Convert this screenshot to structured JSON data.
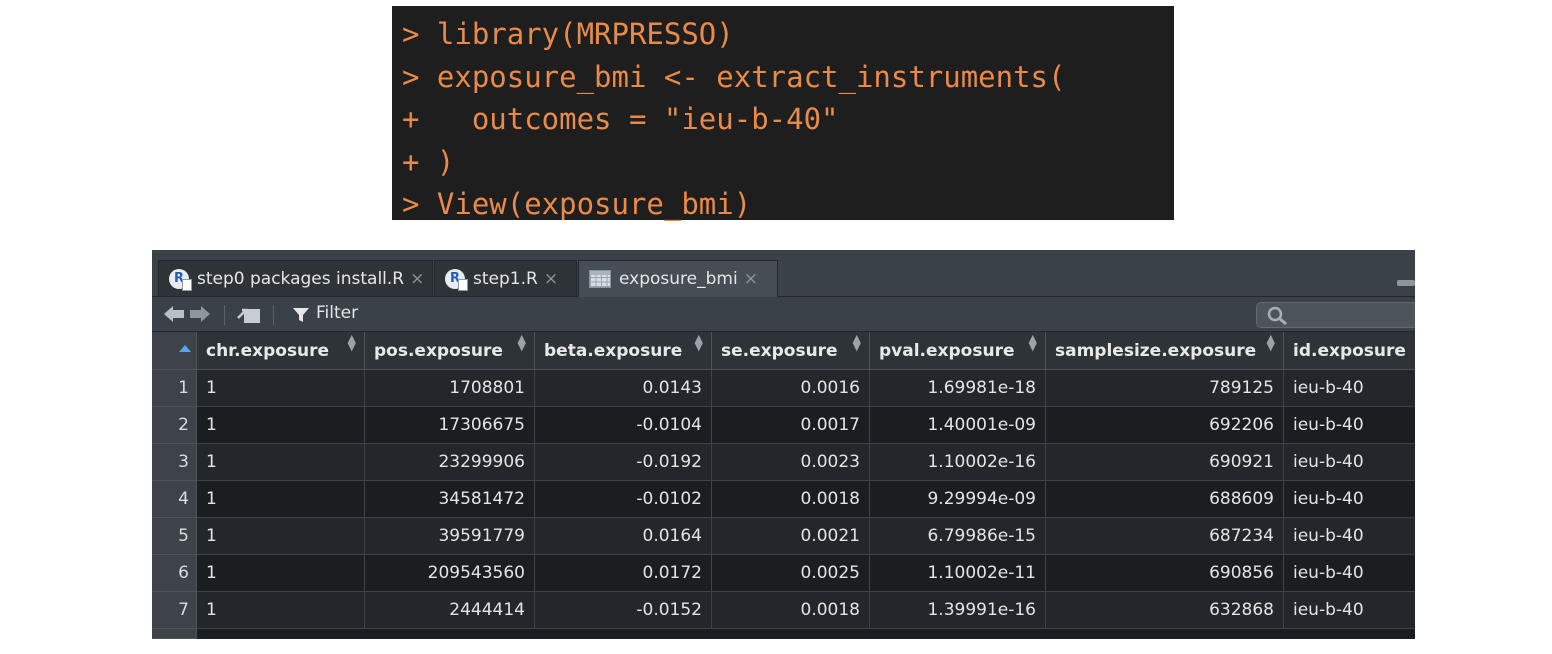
{
  "console": {
    "lines": [
      "> library(MRPRESSO)",
      "> exposure_bmi <- extract_instruments(",
      "+   outcomes = \"ieu-b-40\"",
      "+ )",
      "> View(exposure_bmi)"
    ]
  },
  "viewer": {
    "tabs": [
      {
        "label": "step0 packages install.R",
        "icon": "r-file-icon"
      },
      {
        "label": "step1.R",
        "icon": "r-file-icon"
      },
      {
        "label": "exposure_bmi",
        "icon": "data-grid-icon"
      }
    ],
    "toolbar": {
      "filter_label": "Filter",
      "search_placeholder": ""
    },
    "columns": [
      "chr.exposure",
      "pos.exposure",
      "beta.exposure",
      "se.exposure",
      "pval.exposure",
      "samplesize.exposure",
      "id.exposure"
    ],
    "rows": [
      {
        "n": "1",
        "cells": [
          "1",
          "1708801",
          "0.0143",
          "0.0016",
          "1.69981e-18",
          "789125",
          "ieu-b-40"
        ]
      },
      {
        "n": "2",
        "cells": [
          "1",
          "17306675",
          "-0.0104",
          "0.0017",
          "1.40001e-09",
          "692206",
          "ieu-b-40"
        ]
      },
      {
        "n": "3",
        "cells": [
          "1",
          "23299906",
          "-0.0192",
          "0.0023",
          "1.10002e-16",
          "690921",
          "ieu-b-40"
        ]
      },
      {
        "n": "4",
        "cells": [
          "1",
          "34581472",
          "-0.0102",
          "0.0018",
          "9.29994e-09",
          "688609",
          "ieu-b-40"
        ]
      },
      {
        "n": "5",
        "cells": [
          "1",
          "39591779",
          "0.0164",
          "0.0021",
          "6.79986e-15",
          "687234",
          "ieu-b-40"
        ]
      },
      {
        "n": "6",
        "cells": [
          "1",
          "209543560",
          "0.0172",
          "0.0025",
          "1.10002e-11",
          "690856",
          "ieu-b-40"
        ]
      },
      {
        "n": "7",
        "cells": [
          "1",
          "2444414",
          "-0.0152",
          "0.0018",
          "1.39991e-16",
          "632868",
          "ieu-b-40"
        ]
      }
    ]
  }
}
